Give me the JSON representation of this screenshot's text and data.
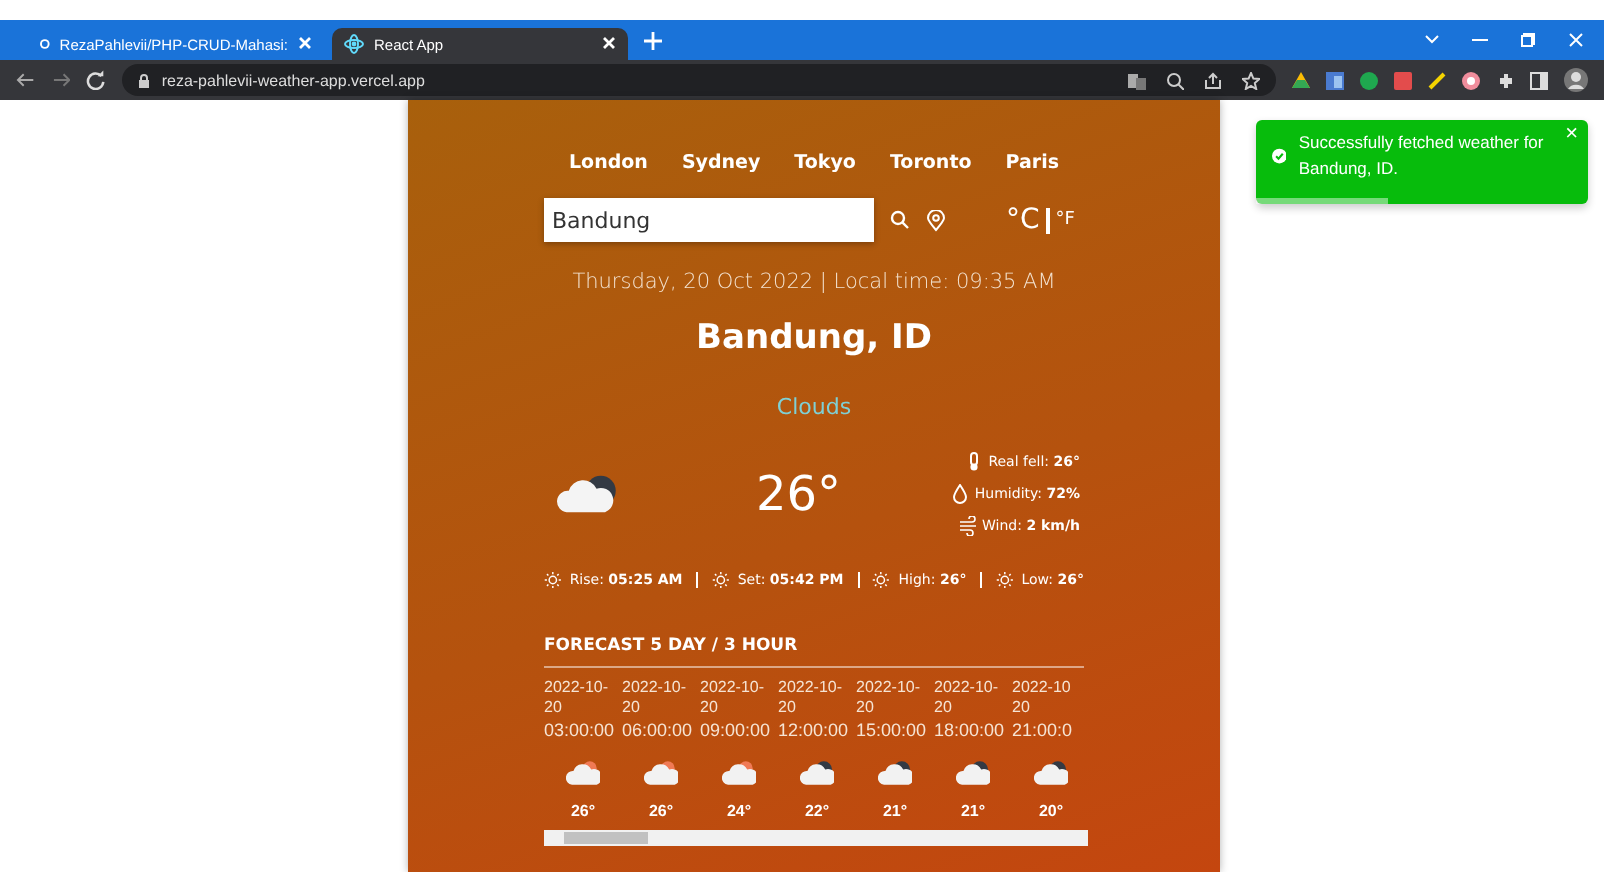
{
  "browser": {
    "tabs": [
      {
        "title": "RezaPahlevii/PHP-CRUD-Mahasi:",
        "selected": false
      },
      {
        "title": "React App",
        "selected": true
      }
    ],
    "url": "reza-pahlevii-weather-app.vercel.app"
  },
  "cities": [
    "London",
    "Sydney",
    "Tokyo",
    "Toronto",
    "Paris"
  ],
  "search": {
    "value": "Bandung"
  },
  "units": [
    {
      "label": "°C",
      "selected": true
    },
    {
      "label": "°F",
      "selected": false
    }
  ],
  "local_time": "Thursday, 20 Oct 2022 | Local time: 09:35 AM",
  "location": "Bandung, ID",
  "condition": "Clouds",
  "temperature": "26°",
  "details": [
    {
      "label": "Real fell: ",
      "value": "26°"
    },
    {
      "label": "Humidity: ",
      "value": "72%"
    },
    {
      "label": "Wind: ",
      "value": "2 km/h"
    }
  ],
  "sun_row": [
    {
      "label": "Rise: ",
      "value": "05:25 AM"
    },
    {
      "label": "Set: ",
      "value": "05:42 PM"
    },
    {
      "label": "High: ",
      "value": "26°"
    },
    {
      "label": "Low: ",
      "value": "26°"
    }
  ],
  "forecast": {
    "title": "FORECAST 5 DAY / 3 HOUR",
    "items": [
      {
        "date": [
          "2022-10-",
          "20"
        ],
        "time": "03:00:00",
        "kind": "day",
        "temp": "26°"
      },
      {
        "date": [
          "2022-10-",
          "20"
        ],
        "time": "06:00:00",
        "kind": "day",
        "temp": "26°"
      },
      {
        "date": [
          "2022-10-",
          "20"
        ],
        "time": "09:00:00",
        "kind": "day",
        "temp": "24°"
      },
      {
        "date": [
          "2022-10-",
          "20"
        ],
        "time": "12:00:00",
        "kind": "night",
        "temp": "22°"
      },
      {
        "date": [
          "2022-10-",
          "20"
        ],
        "time": "15:00:00",
        "kind": "night",
        "temp": "21°"
      },
      {
        "date": [
          "2022-10-",
          "20"
        ],
        "time": "18:00:00",
        "kind": "night",
        "temp": "21°"
      },
      {
        "date": [
          "2022-10",
          "20"
        ],
        "time": "21:00:0",
        "kind": "night",
        "temp": "20°"
      }
    ]
  },
  "toast": {
    "message": "Successfully fetched weather for Bandung, ID.",
    "close": "×",
    "level": 0.4
  }
}
